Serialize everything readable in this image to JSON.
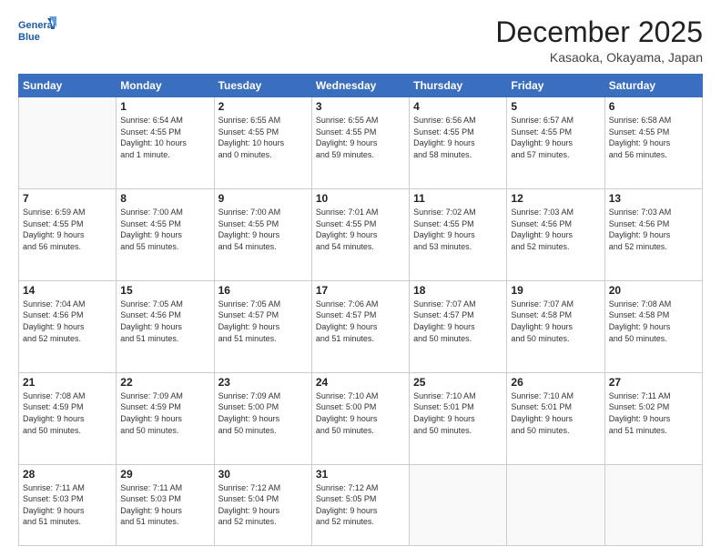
{
  "header": {
    "logo_line1": "General",
    "logo_line2": "Blue",
    "month": "December 2025",
    "location": "Kasaoka, Okayama, Japan"
  },
  "days_of_week": [
    "Sunday",
    "Monday",
    "Tuesday",
    "Wednesday",
    "Thursday",
    "Friday",
    "Saturday"
  ],
  "weeks": [
    [
      {
        "day": "",
        "info": ""
      },
      {
        "day": "1",
        "info": "Sunrise: 6:54 AM\nSunset: 4:55 PM\nDaylight: 10 hours\nand 1 minute."
      },
      {
        "day": "2",
        "info": "Sunrise: 6:55 AM\nSunset: 4:55 PM\nDaylight: 10 hours\nand 0 minutes."
      },
      {
        "day": "3",
        "info": "Sunrise: 6:55 AM\nSunset: 4:55 PM\nDaylight: 9 hours\nand 59 minutes."
      },
      {
        "day": "4",
        "info": "Sunrise: 6:56 AM\nSunset: 4:55 PM\nDaylight: 9 hours\nand 58 minutes."
      },
      {
        "day": "5",
        "info": "Sunrise: 6:57 AM\nSunset: 4:55 PM\nDaylight: 9 hours\nand 57 minutes."
      },
      {
        "day": "6",
        "info": "Sunrise: 6:58 AM\nSunset: 4:55 PM\nDaylight: 9 hours\nand 56 minutes."
      }
    ],
    [
      {
        "day": "7",
        "info": "Sunrise: 6:59 AM\nSunset: 4:55 PM\nDaylight: 9 hours\nand 56 minutes."
      },
      {
        "day": "8",
        "info": "Sunrise: 7:00 AM\nSunset: 4:55 PM\nDaylight: 9 hours\nand 55 minutes."
      },
      {
        "day": "9",
        "info": "Sunrise: 7:00 AM\nSunset: 4:55 PM\nDaylight: 9 hours\nand 54 minutes."
      },
      {
        "day": "10",
        "info": "Sunrise: 7:01 AM\nSunset: 4:55 PM\nDaylight: 9 hours\nand 54 minutes."
      },
      {
        "day": "11",
        "info": "Sunrise: 7:02 AM\nSunset: 4:55 PM\nDaylight: 9 hours\nand 53 minutes."
      },
      {
        "day": "12",
        "info": "Sunrise: 7:03 AM\nSunset: 4:56 PM\nDaylight: 9 hours\nand 52 minutes."
      },
      {
        "day": "13",
        "info": "Sunrise: 7:03 AM\nSunset: 4:56 PM\nDaylight: 9 hours\nand 52 minutes."
      }
    ],
    [
      {
        "day": "14",
        "info": "Sunrise: 7:04 AM\nSunset: 4:56 PM\nDaylight: 9 hours\nand 52 minutes."
      },
      {
        "day": "15",
        "info": "Sunrise: 7:05 AM\nSunset: 4:56 PM\nDaylight: 9 hours\nand 51 minutes."
      },
      {
        "day": "16",
        "info": "Sunrise: 7:05 AM\nSunset: 4:57 PM\nDaylight: 9 hours\nand 51 minutes."
      },
      {
        "day": "17",
        "info": "Sunrise: 7:06 AM\nSunset: 4:57 PM\nDaylight: 9 hours\nand 51 minutes."
      },
      {
        "day": "18",
        "info": "Sunrise: 7:07 AM\nSunset: 4:57 PM\nDaylight: 9 hours\nand 50 minutes."
      },
      {
        "day": "19",
        "info": "Sunrise: 7:07 AM\nSunset: 4:58 PM\nDaylight: 9 hours\nand 50 minutes."
      },
      {
        "day": "20",
        "info": "Sunrise: 7:08 AM\nSunset: 4:58 PM\nDaylight: 9 hours\nand 50 minutes."
      }
    ],
    [
      {
        "day": "21",
        "info": "Sunrise: 7:08 AM\nSunset: 4:59 PM\nDaylight: 9 hours\nand 50 minutes."
      },
      {
        "day": "22",
        "info": "Sunrise: 7:09 AM\nSunset: 4:59 PM\nDaylight: 9 hours\nand 50 minutes."
      },
      {
        "day": "23",
        "info": "Sunrise: 7:09 AM\nSunset: 5:00 PM\nDaylight: 9 hours\nand 50 minutes."
      },
      {
        "day": "24",
        "info": "Sunrise: 7:10 AM\nSunset: 5:00 PM\nDaylight: 9 hours\nand 50 minutes."
      },
      {
        "day": "25",
        "info": "Sunrise: 7:10 AM\nSunset: 5:01 PM\nDaylight: 9 hours\nand 50 minutes."
      },
      {
        "day": "26",
        "info": "Sunrise: 7:10 AM\nSunset: 5:01 PM\nDaylight: 9 hours\nand 50 minutes."
      },
      {
        "day": "27",
        "info": "Sunrise: 7:11 AM\nSunset: 5:02 PM\nDaylight: 9 hours\nand 51 minutes."
      }
    ],
    [
      {
        "day": "28",
        "info": "Sunrise: 7:11 AM\nSunset: 5:03 PM\nDaylight: 9 hours\nand 51 minutes."
      },
      {
        "day": "29",
        "info": "Sunrise: 7:11 AM\nSunset: 5:03 PM\nDaylight: 9 hours\nand 51 minutes."
      },
      {
        "day": "30",
        "info": "Sunrise: 7:12 AM\nSunset: 5:04 PM\nDaylight: 9 hours\nand 52 minutes."
      },
      {
        "day": "31",
        "info": "Sunrise: 7:12 AM\nSunset: 5:05 PM\nDaylight: 9 hours\nand 52 minutes."
      },
      {
        "day": "",
        "info": ""
      },
      {
        "day": "",
        "info": ""
      },
      {
        "day": "",
        "info": ""
      }
    ]
  ]
}
